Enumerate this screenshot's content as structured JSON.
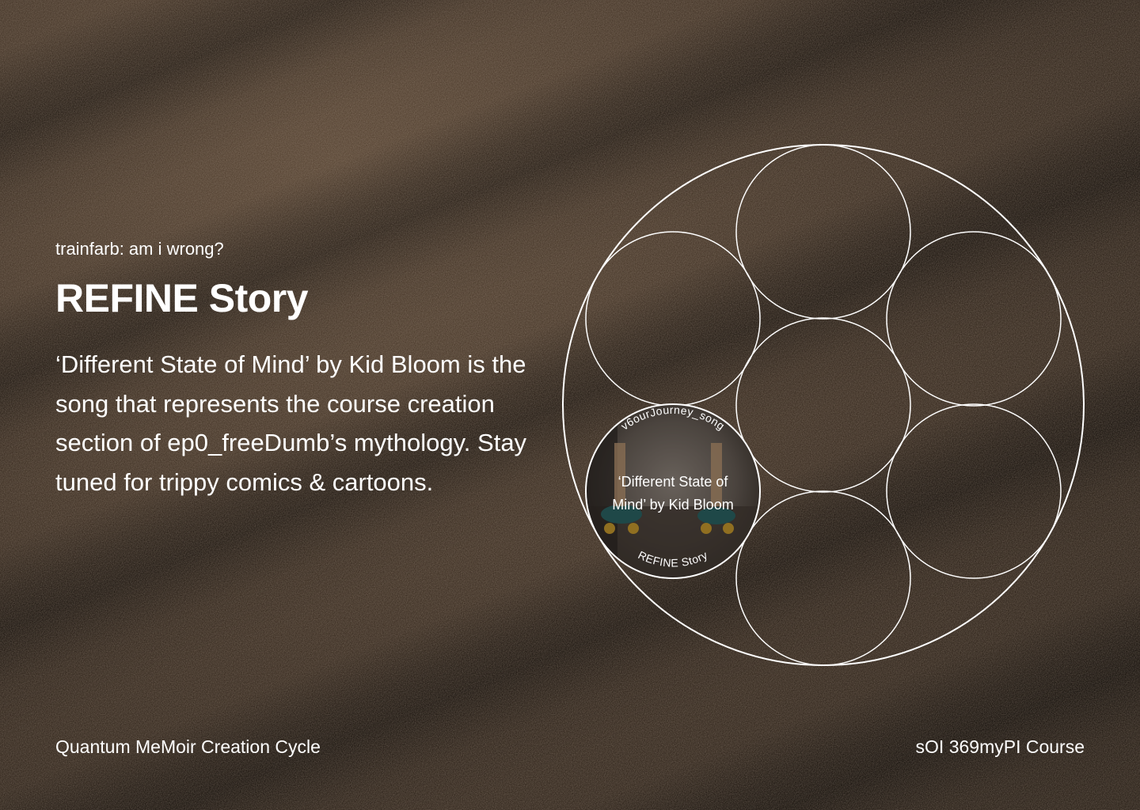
{
  "hero": {
    "subtitle": "trainfarb: am i wrong?",
    "title": "REFINE Story",
    "description": "‘Different State of Mind’ by Kid Bloom is the song that represents the course creation section of ep0_freeDumb’s mythology. Stay tuned for trippy comics & cartoons."
  },
  "diagram": {
    "active_circle": {
      "top_label": "v6ourJourney_song",
      "caption_line1": "‘Different State of",
      "caption_line2": "Mind’ by Kid Bloom",
      "bottom_label": "REFINE Story"
    }
  },
  "footer": {
    "left": "Quantum MeMoir Creation Cycle",
    "right": "sOI 369myPI Course"
  },
  "colors": {
    "background": "#3a2d22",
    "stroke": "#ffffff"
  }
}
